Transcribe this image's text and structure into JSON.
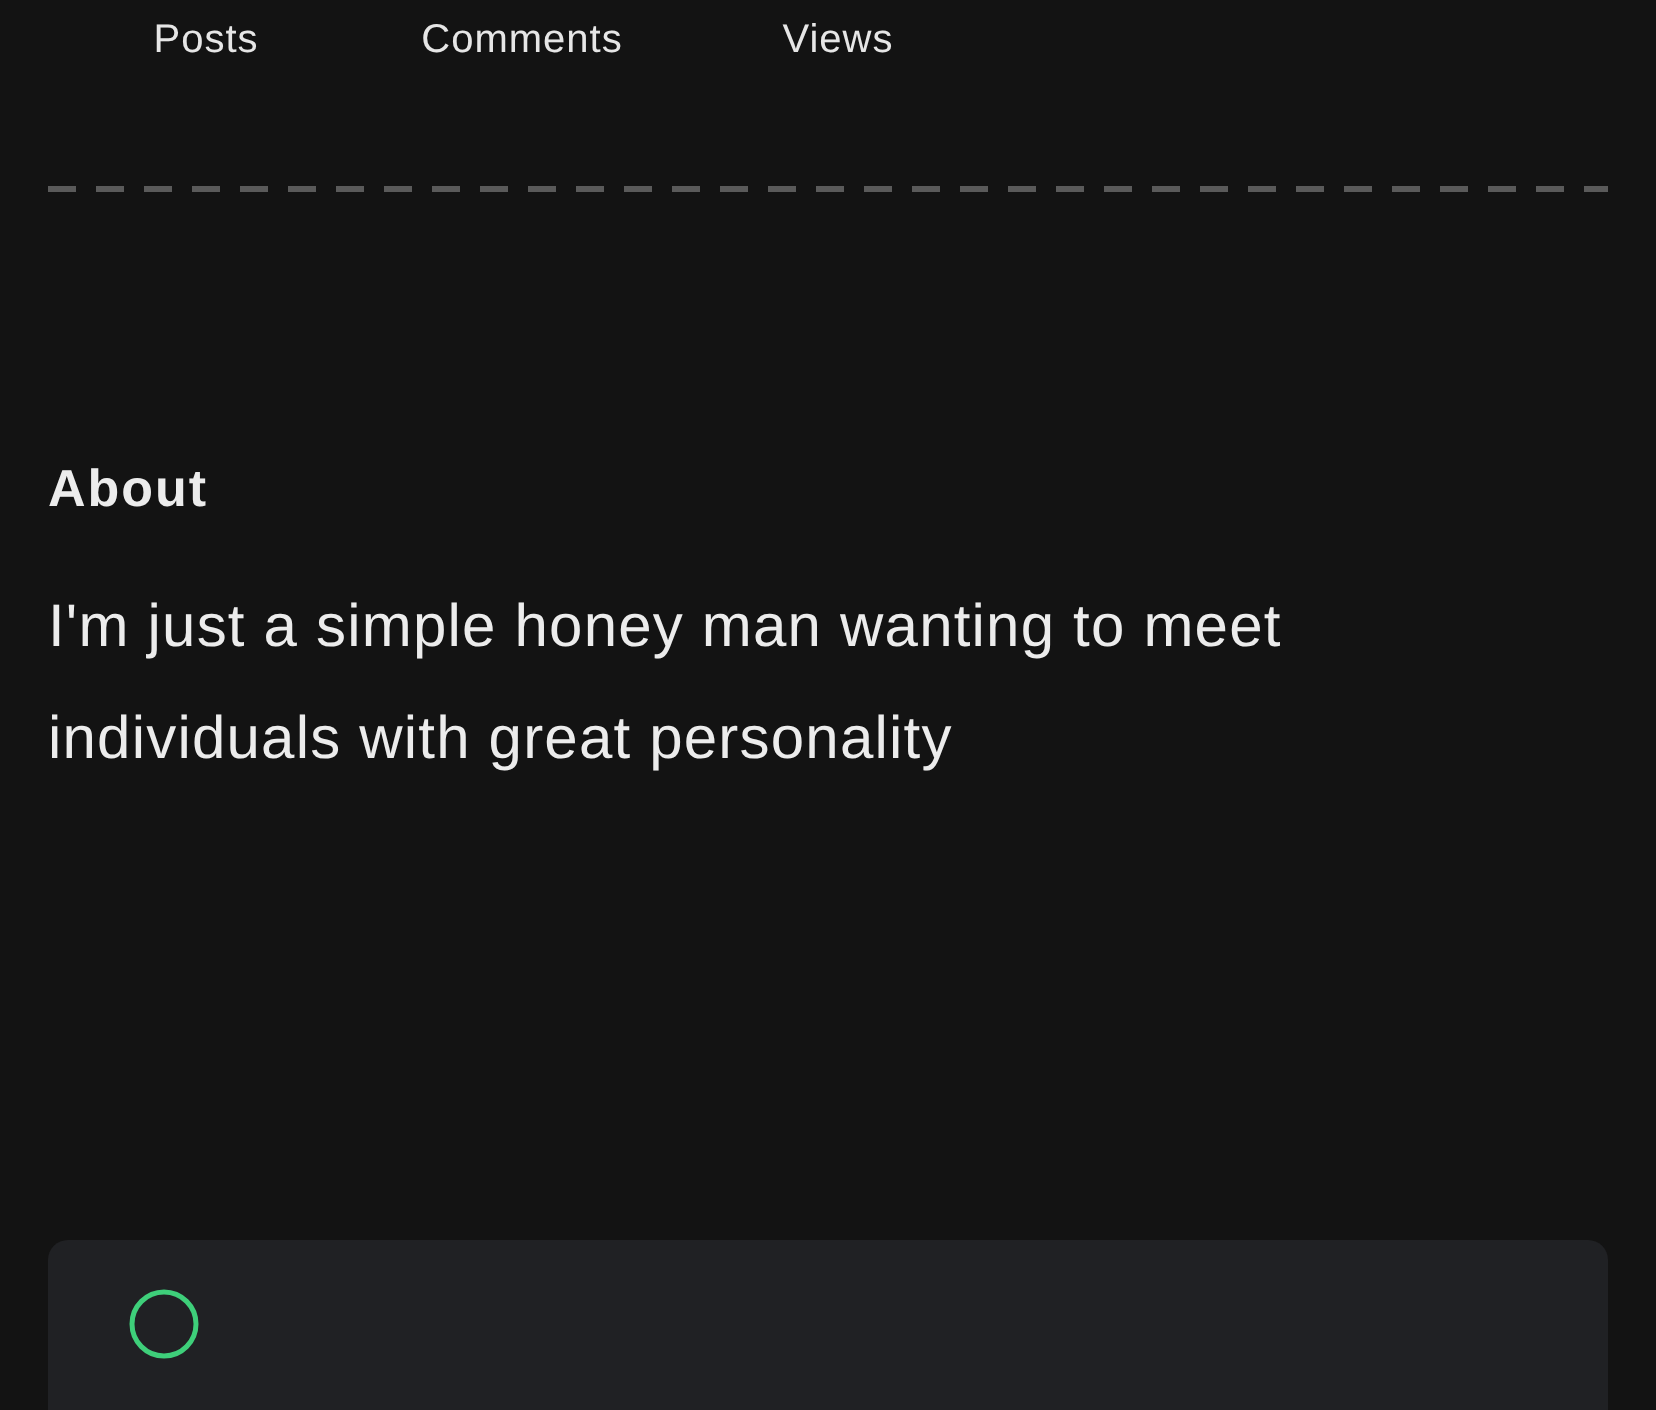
{
  "stats": [
    {
      "label": "Posts"
    },
    {
      "label": "Comments"
    },
    {
      "label": "Views"
    }
  ],
  "about": {
    "title": "About",
    "text": "I'm just a simple honey man wanting to meet individuals with great personality"
  }
}
